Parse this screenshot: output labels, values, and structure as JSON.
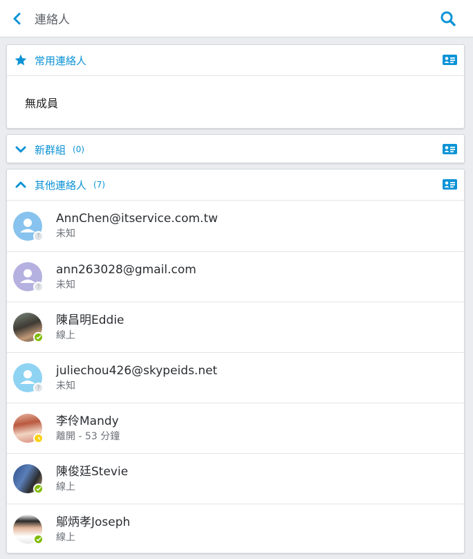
{
  "header": {
    "title": "連絡人"
  },
  "favorites": {
    "title": "常用連絡人",
    "empty_text": "無成員"
  },
  "new_group": {
    "title": "新群組",
    "count": "(0)"
  },
  "other": {
    "title": "其他連絡人",
    "count": "(7)",
    "contacts": [
      {
        "name": "AnnChen@itservice.com.tw",
        "status": "未知",
        "presence": "unknown",
        "avatar": "default-blue"
      },
      {
        "name": "ann263028@gmail.com",
        "status": "未知",
        "presence": "unknown",
        "avatar": "default-purple"
      },
      {
        "name": "陳昌明Eddie",
        "status": "線上",
        "presence": "online",
        "avatar": "photo"
      },
      {
        "name": "juliechou426@skypeids.net",
        "status": "未知",
        "presence": "unknown",
        "avatar": "default-lightblue"
      },
      {
        "name": "李伶Mandy",
        "status": "離開 - 53 分鐘",
        "presence": "away",
        "avatar": "photo"
      },
      {
        "name": "陳俊廷Stevie",
        "status": "線上",
        "presence": "online",
        "avatar": "photo"
      },
      {
        "name": "鄔炳孝Joseph",
        "status": "線上",
        "presence": "online",
        "avatar": "photo"
      }
    ]
  },
  "colors": {
    "accent": "#0b93d6",
    "online": "#7fba00",
    "away": "#fcd116",
    "unknown": "#c7ccd1"
  }
}
